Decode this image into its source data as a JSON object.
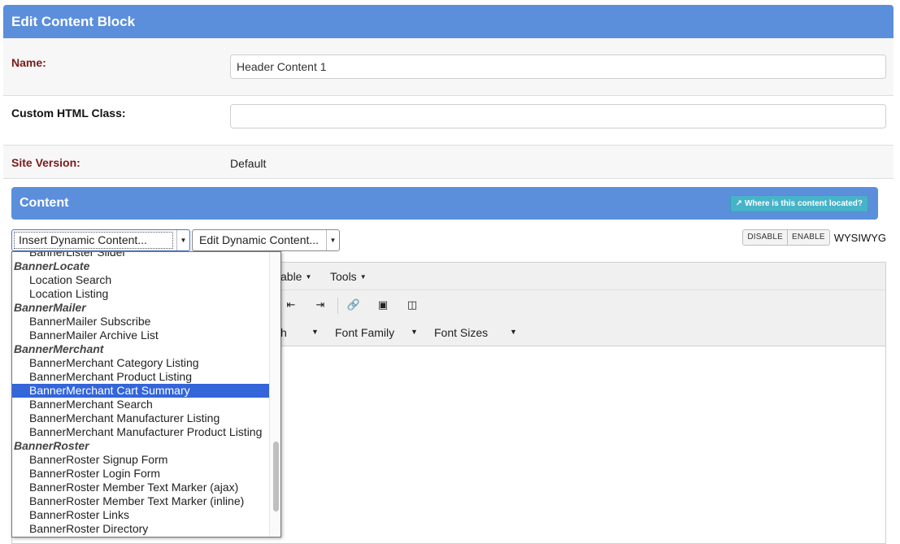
{
  "header": {
    "title": "Edit Content Block"
  },
  "form": {
    "name_label": "Name:",
    "name_value": "Header Content 1",
    "class_label": "Custom HTML Class:",
    "class_value": "",
    "version_label": "Site Version:",
    "version_value": "Default"
  },
  "content": {
    "title": "Content",
    "where_label": "Where is this content located?"
  },
  "selects": {
    "insert": "Insert Dynamic Content...",
    "edit": "Edit Dynamic Content..."
  },
  "mode": {
    "disable": "DISABLE",
    "enable": "ENABLE",
    "label": "WYSIWYG"
  },
  "editor": {
    "menus": [
      "able",
      "Tools"
    ],
    "toolbar2": [
      "h",
      "Font Family",
      "Font Sizes"
    ]
  },
  "dropdown": {
    "partial_top": "BannerLister Slider",
    "entries": [
      {
        "type": "group",
        "label": "BannerLocate"
      },
      {
        "type": "option",
        "label": "Location Search"
      },
      {
        "type": "option",
        "label": "Location Listing"
      },
      {
        "type": "group",
        "label": "BannerMailer"
      },
      {
        "type": "option",
        "label": "BannerMailer Subscribe"
      },
      {
        "type": "option",
        "label": "BannerMailer Archive List"
      },
      {
        "type": "group",
        "label": "BannerMerchant"
      },
      {
        "type": "option",
        "label": "BannerMerchant Category Listing"
      },
      {
        "type": "option",
        "label": "BannerMerchant Product Listing"
      },
      {
        "type": "option",
        "label": "BannerMerchant Cart Summary",
        "selected": true
      },
      {
        "type": "option",
        "label": "BannerMerchant Search"
      },
      {
        "type": "option",
        "label": "BannerMerchant Manufacturer Listing"
      },
      {
        "type": "option",
        "label": "BannerMerchant Manufacturer Product Listing"
      },
      {
        "type": "group",
        "label": "BannerRoster"
      },
      {
        "type": "option",
        "label": "BannerRoster Signup Form"
      },
      {
        "type": "option",
        "label": "BannerRoster Login Form"
      },
      {
        "type": "option",
        "label": "BannerRoster Member Text Marker (ajax)"
      },
      {
        "type": "option",
        "label": "BannerRoster Member Text Marker (inline)"
      },
      {
        "type": "option",
        "label": "BannerRoster Links"
      },
      {
        "type": "option",
        "label": "BannerRoster Directory"
      }
    ]
  },
  "colors": {
    "header_bg": "#5b8fdc",
    "info_btn": "#47b3c9",
    "selected_bg": "#3465d9",
    "required_label": "#7a1a1a"
  }
}
